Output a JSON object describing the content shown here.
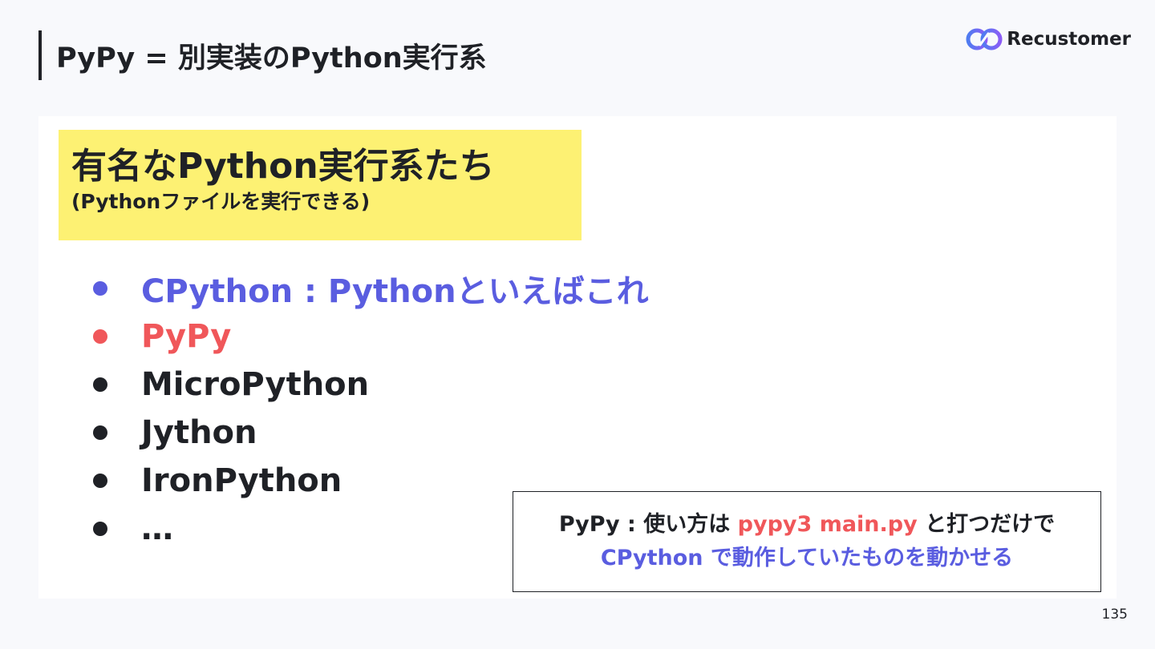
{
  "slide": {
    "title": "PyPy = 別実装のPython実行系",
    "page_number": "135"
  },
  "logo": {
    "text": "Recustomer",
    "icon": "infinity-loop-icon",
    "colors": [
      "#4f7cf0",
      "#8b5cf6"
    ]
  },
  "heading": {
    "main": "有名なPython実行系たち",
    "sub": "(Pythonファイルを実行できる)",
    "background": "#fdf173"
  },
  "bullets": [
    {
      "text": "CPython : Pythonといえばこれ",
      "color": "#5a5de0"
    },
    {
      "text": "PyPy",
      "color": "#f0575a"
    },
    {
      "text": "MicroPython",
      "color": "#1f2126"
    },
    {
      "text": "Jython",
      "color": "#1f2126"
    },
    {
      "text": "IronPython",
      "color": "#1f2126"
    },
    {
      "text": " …",
      "color": "#1f2126"
    }
  ],
  "note": {
    "line1_prefix": "PyPy : 使い方は ",
    "line1_code": "pypy3 main.py",
    "line1_suffix": " と打つだけで",
    "line2": "CPython で動作していたものを動かせる",
    "code_color": "#f0575a",
    "line2_color": "#5a5de0"
  }
}
